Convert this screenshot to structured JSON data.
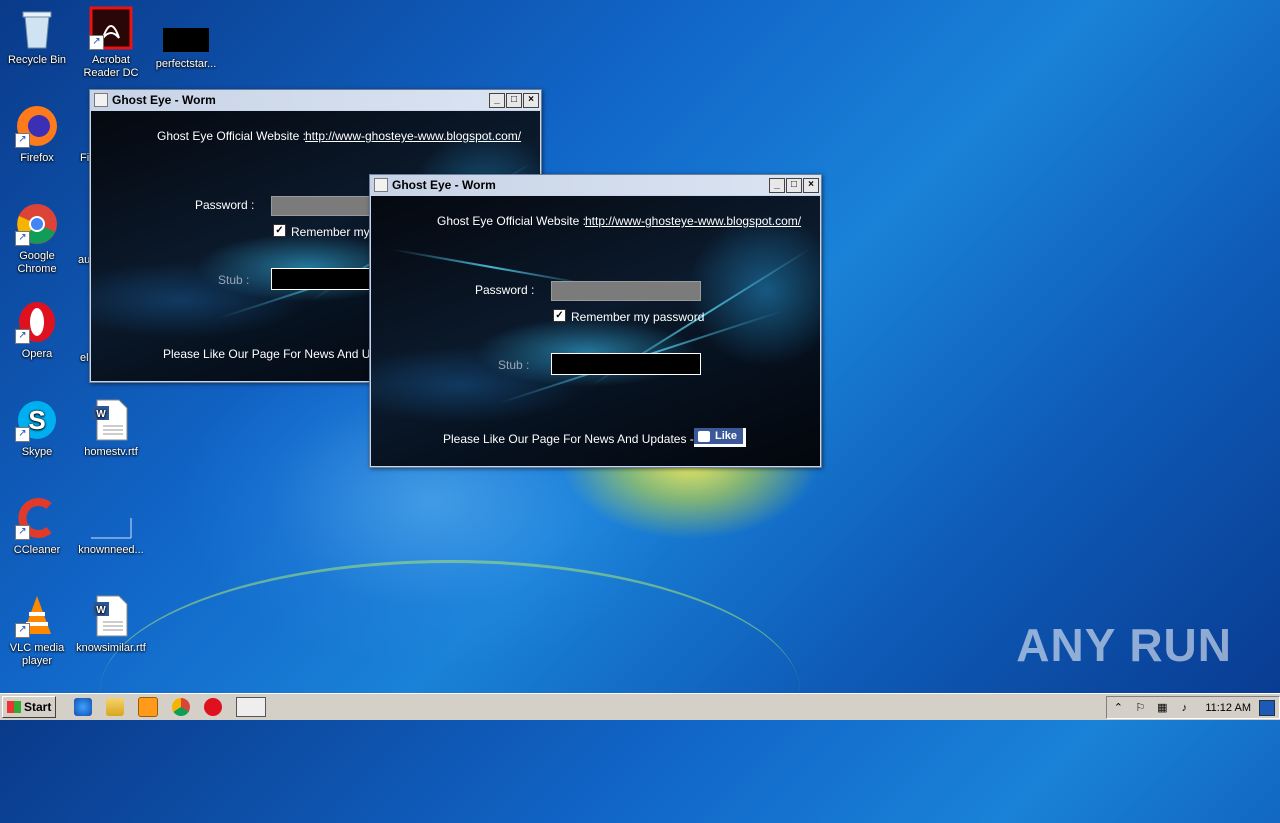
{
  "desktop": {
    "icons": [
      {
        "label": "Recycle Bin"
      },
      {
        "label": "Acrobat Reader DC"
      },
      {
        "label": "perfectstar..."
      },
      {
        "label": "Firefox"
      },
      {
        "label": "Fi"
      },
      {
        "label": "Google Chrome"
      },
      {
        "label": "au"
      },
      {
        "label": "Opera"
      },
      {
        "label": "el"
      },
      {
        "label": "Skype"
      },
      {
        "label": "homestv.rtf"
      },
      {
        "label": "CCleaner"
      },
      {
        "label": "knownneed..."
      },
      {
        "label": "VLC media player"
      },
      {
        "label": "knowsimilar.rtf"
      }
    ]
  },
  "window_back": {
    "title": "Ghost Eye - Worm",
    "website_label": "Ghost Eye Official Website  :",
    "website_link": "http://www-ghosteye-www.blogspot.com/",
    "password_label": "Password :",
    "remember_label": "Remember   my p",
    "stub_label": "Stub :",
    "promo_text": "Please Like Our Page For News And Updat"
  },
  "window_front": {
    "title": "Ghost Eye - Worm",
    "website_label": "Ghost Eye Official Website  :",
    "website_link": "http://www-ghosteye-www.blogspot.com/",
    "password_label": "Password :",
    "remember_label": "Remember   my password",
    "stub_label": "Stub :",
    "promo_text": "Please Like Our Page For News And Updates ->",
    "like_label": "Like"
  },
  "taskbar": {
    "start_label": "Start",
    "clock": "11:12 AM"
  },
  "watermark": "ANY RUN"
}
